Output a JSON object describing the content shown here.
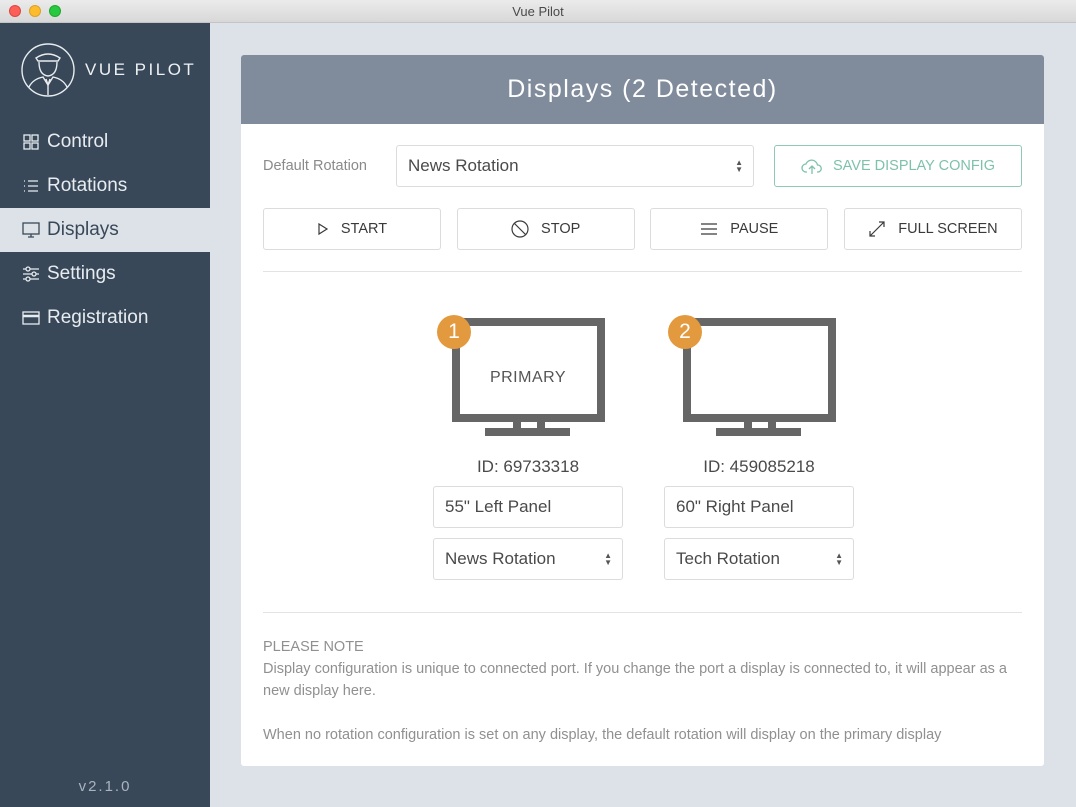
{
  "window": {
    "title": "Vue Pilot"
  },
  "sidebar": {
    "brand": "VUE PILOT",
    "items": [
      {
        "label": "Control",
        "icon": "grid-icon",
        "active": false
      },
      {
        "label": "Rotations",
        "icon": "list-icon",
        "active": false
      },
      {
        "label": "Displays",
        "icon": "monitor-icon",
        "active": true
      },
      {
        "label": "Settings",
        "icon": "sliders-icon",
        "active": false
      },
      {
        "label": "Registration",
        "icon": "card-icon",
        "active": false
      }
    ],
    "version": "v2.1.0"
  },
  "panel": {
    "title": "Displays (2 Detected)",
    "default_rotation_label": "Default Rotation",
    "default_rotation_value": "News Rotation",
    "save_label": "SAVE DISPLAY CONFIG",
    "buttons": {
      "start": "START",
      "stop": "STOP",
      "pause": "PAUSE",
      "fullscreen": "FULL SCREEN"
    },
    "displays": [
      {
        "number": "1",
        "primary_label": "PRIMARY",
        "id": "ID: 69733318",
        "name": "55\" Left Panel",
        "rotation": "News Rotation"
      },
      {
        "number": "2",
        "primary_label": "",
        "id": "ID: 459085218",
        "name": "60\" Right Panel",
        "rotation": "Tech Rotation"
      }
    ],
    "note": {
      "heading": "PLEASE NOTE",
      "line1": "Display configuration is unique to connected port. If you change the port a display is connected to, it will appear as a new display here.",
      "line2": "When no rotation configuration is set on any display, the default rotation will display on the primary display"
    }
  },
  "colors": {
    "sidebar": "#384858",
    "header": "#808c9c",
    "accent": "#7fc1aa",
    "badge": "#e39a3e"
  }
}
